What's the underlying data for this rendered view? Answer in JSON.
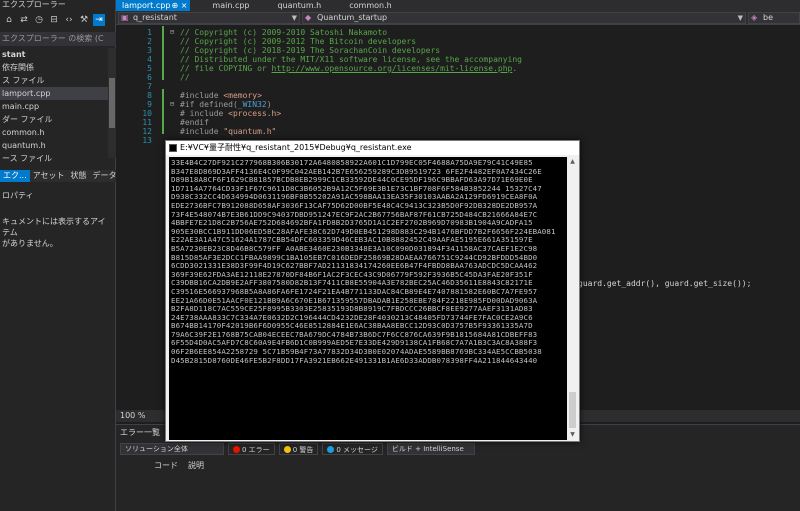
{
  "solution_explorer": {
    "title": "エクスプローラー",
    "search_placeholder": "エクスプローラー の検索 (C",
    "tree": [
      {
        "label": "stant",
        "bold": true,
        "selected": false
      },
      {
        "label": "依存関係",
        "bold": false,
        "selected": false
      },
      {
        "label": "ス ファイル",
        "bold": false,
        "selected": false
      },
      {
        "label": "lamport.cpp",
        "bold": false,
        "selected": true
      },
      {
        "label": "main.cpp",
        "bold": false,
        "selected": false
      },
      {
        "label": "ダー ファイル",
        "bold": false,
        "selected": false
      },
      {
        "label": "common.h",
        "bold": false,
        "selected": false
      },
      {
        "label": "quantum.h",
        "bold": false,
        "selected": false
      },
      {
        "label": "ース ファイル",
        "bold": false,
        "selected": false
      }
    ],
    "bottom_tabs": [
      "エク...",
      "アセット",
      "状態",
      "データ"
    ]
  },
  "properties": {
    "title": "ロパティ",
    "message_line1": "キュメントには表示するアイテム",
    "message_line2": "がありません。"
  },
  "editor_tabs": [
    {
      "label": "lamport.cpp",
      "active": true,
      "pin": "⊕ ×"
    },
    {
      "label": "main.cpp",
      "active": false
    },
    {
      "label": "quantum.h",
      "active": false
    },
    {
      "label": "common.h",
      "active": false
    }
  ],
  "navigation": {
    "project": "q_resistant",
    "scope": "Quantum_startup",
    "member": "be"
  },
  "code_lines": [
    {
      "n": "1",
      "parts": [
        {
          "t": "// Copyright (c) 2009-2010 Satoshi Nakamoto",
          "c": "cm"
        }
      ]
    },
    {
      "n": "2",
      "parts": [
        {
          "t": "// Copyright (c) 2009-2012 The Bitcoin developers",
          "c": "cm"
        }
      ]
    },
    {
      "n": "3",
      "parts": [
        {
          "t": "// Copyright (c) 2018-2019 The SorachanCoin developers",
          "c": "cm"
        }
      ]
    },
    {
      "n": "4",
      "parts": [
        {
          "t": "// Distributed under the MIT/X11 software license, see the accompanying",
          "c": "cm"
        }
      ]
    },
    {
      "n": "5",
      "parts": [
        {
          "t": "// file COPYING or ",
          "c": "cm"
        },
        {
          "t": "http://www.opensource.org/licenses/mit-license.php",
          "c": "link"
        },
        {
          "t": ".",
          "c": "cm"
        }
      ]
    },
    {
      "n": "6",
      "parts": [
        {
          "t": "//",
          "c": "cm"
        }
      ]
    },
    {
      "n": "7",
      "parts": [
        {
          "t": "",
          "c": "cm"
        }
      ]
    },
    {
      "n": "8",
      "parts": [
        {
          "t": "#include ",
          "c": "pp"
        },
        {
          "t": "<memory>",
          "c": "str"
        }
      ]
    },
    {
      "n": "9",
      "parts": [
        {
          "t": "#if defined(",
          "c": "pp"
        },
        {
          "t": "_WIN32",
          "c": "kw"
        },
        {
          "t": ")",
          "c": "pp"
        }
      ]
    },
    {
      "n": "10",
      "parts": [
        {
          "t": "# include ",
          "c": "pp"
        },
        {
          "t": "<process.h>",
          "c": "str"
        }
      ]
    },
    {
      "n": "11",
      "parts": [
        {
          "t": "#endif",
          "c": "pp"
        }
      ]
    },
    {
      "n": "12",
      "parts": [
        {
          "t": "#include ",
          "c": "pp"
        },
        {
          "t": "\"quantum.h\"",
          "c": "str"
        }
      ]
    },
    {
      "n": "13",
      "parts": [
        {
          "t": "",
          "c": "cm"
        }
      ]
    }
  ],
  "code_right_fragment": "guard.get_addr(), guard.get_size());",
  "zoom": "100 %",
  "error_list": {
    "title": "エラー一覧",
    "scope": "ソリューション全体",
    "errors": "0 エラー",
    "warnings": "0 警告",
    "messages": "0 メッセージ",
    "build_filter": "ビルド + IntelliSense",
    "col_code": "コード",
    "col_desc": "説明"
  },
  "console": {
    "title": "E:¥VC¥量子耐性¥q_resistant_2015¥Debug¥q_resistant.exe",
    "lines": [
      "33E4B4C27DF921C277968B306B30172A6480858922A601C1D799EC05F4688A75DA9E79C41C49E85",
      "B347E8D869D3AFF4136E4C0F99C042AEB142B7E656259289C3D89519723 6FE2F4482EF0A7434C26E",
      "D89B18A8CF6F1629CB81857BCDB8EB2999C1CB33592DE44C0CE95DF196C9BBAFD63A97D71E69E0E",
      "1D7114A7764CD33F1F67C9611D8C3B6052B9A12C5F69E3B1E73C1BF708F6F584B3852244 15327C47",
      "D938C332CC4D634994D0631196BF8B55202A91AC598BAA13EA35F30103AABA2A129FD6919CEA8F0A",
      "EDE2736BFC7B912088D658AF3036F13CAF75D62D00BF5E48C4C9413C323B5D0F92DB328DE2DB957A",
      "73F4E548074B7E3B61DD9C94037DBD951247EC9F2AC2B67756BAF87F61CB725D484CB21666A84E7C",
      "4BBFE7E21D8C2B756AE752D684692BFA1FD8B2D3765D1A1C2EF2702B969D70983B1904A9CADFA15",
      "905E30BCC1B911DD06ED5BC28AFAFE38C62D749D0EB451298D883C294B1476BFDD7B2F6656F224EBA081",
      "E22AE3A1A47C51624A1787CBB54DFC603359D46CEB3AC10B8882452C49AAFAE5195E661A351597E",
      "B5A7230EB23C8D46B8C579FF A0ABE3460E230B3348E3A10C090D031894F341158AC37CAEF1E2C98",
      "B815D85AF3E2DCC1FBAA9899C1BA105EB7C016DEDF25869B28DAEAA766751C9244CD92BFDDD54BD0",
      "6CDD3021331E38D3F99F4D19C627BBF7AD21131834174260EE6B47F4FBDD8BAA763ADCDC5DCAA462",
      "369F39E62FDA3AE12118E27870DF84B6F1AC2F3CEC43C9D06779F592F3936B5C45DA3FAE20F351F",
      "C39DBB16CA2DB9E2AFF3807580D82B13F7411CB8E55904A3E782BEC25AC46D35611E8843C82171E",
      "C39516E566937968B5A8A86FA6FE1724F21EA4B771133DAC84CB89E4E7407881582E60BC7A7FE957",
      "EE21A66D0E51AACF0E121BB9A6C670E1B671359557DBADAB1E258EBE784F2218E985FD00DAD9063A",
      "B2FA8D118C7AC559CE25F8995B3303E25835193D8B8919C7FBDCCC26BBCF8EE9277AAEF3131AD83",
      "24E738AAA833C7C334A7E0632D2C196444CD4232DE28F4030213C48405FD73744FE7FAC0CE2A9C6",
      "B674BB14170F42019B6F6D0955C46E8512884E1E6AC38BAA8EBCC12D93C0D3757B5F93361335A7D",
      "79A6C39F2E1768B75CAB04ECEEC7BA679DC4784B73B6DC7F6CC876CA639F9B1815684A81CDBEFF83",
      "6F55D4D0AC5AFD7C8C60A9E4FB6D1C0B999AED5E7E33DE429D9138CA1FB68C7A7A1B3C3AC8A388F3",
      "06F2B6EE854A2258729 5C71B59B4F73A77832D34D3B0E02074ADAE5589BB8769BC334AE5CCBB5038",
      "D45B2815D8760DE46FE5B2F8DD17FA3921EB662E491331B1AE6D33ADDB078398FF4A211844643440"
    ]
  }
}
